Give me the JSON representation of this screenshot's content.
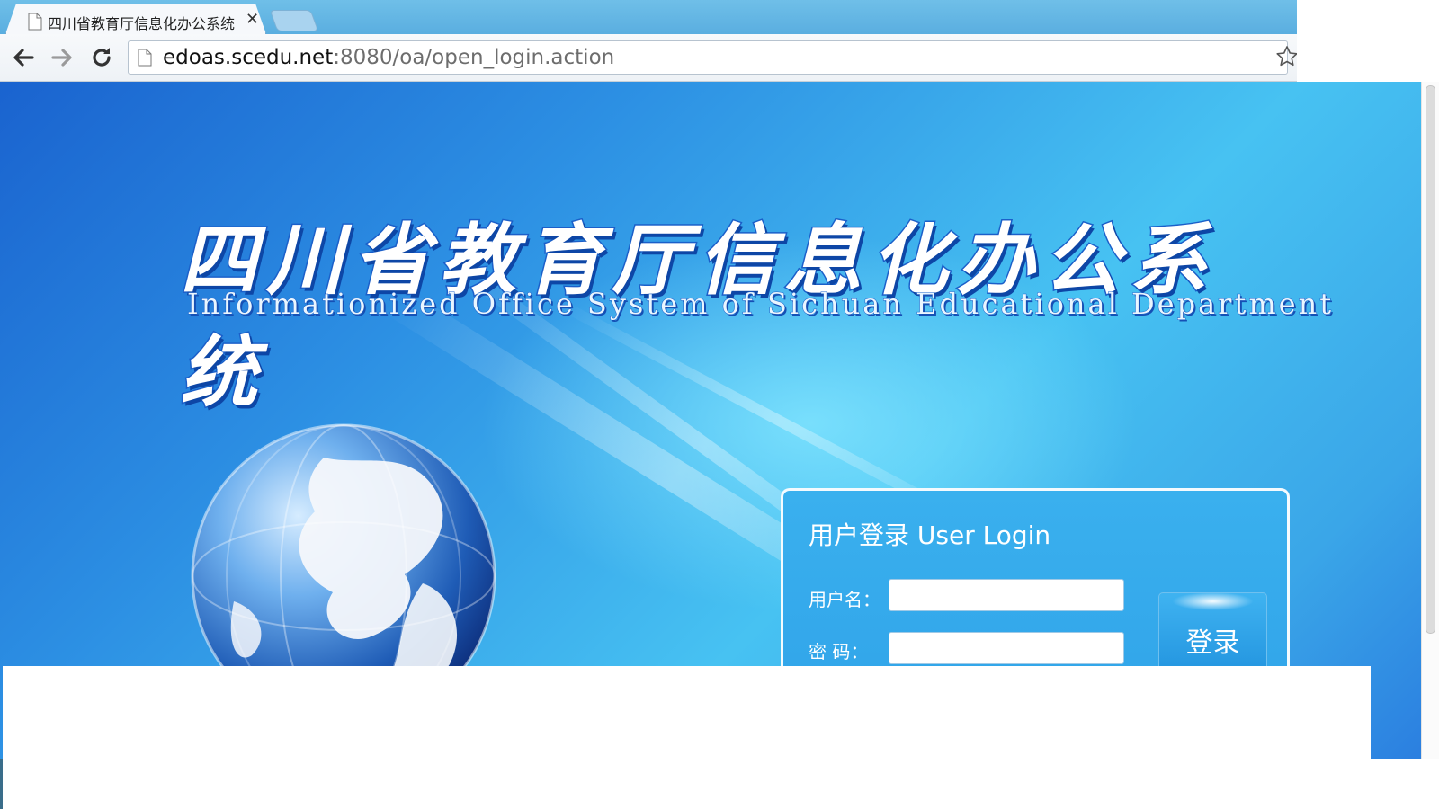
{
  "browser": {
    "tab": {
      "title": "四川省教育厅信息化办公系统"
    },
    "url": {
      "host": "edoas.scedu.net",
      "path": ":8080/oa/open_login.action"
    }
  },
  "page": {
    "heading_cn": "四川省教育厅信息化办公系统",
    "heading_en": "Informationized Office System of Sichuan Educational Department"
  },
  "login": {
    "title": "用户登录 User Login",
    "username_label": "用户名：",
    "username_value": "",
    "password_label": "密  码：",
    "password_value": "",
    "button_label": "登录"
  }
}
